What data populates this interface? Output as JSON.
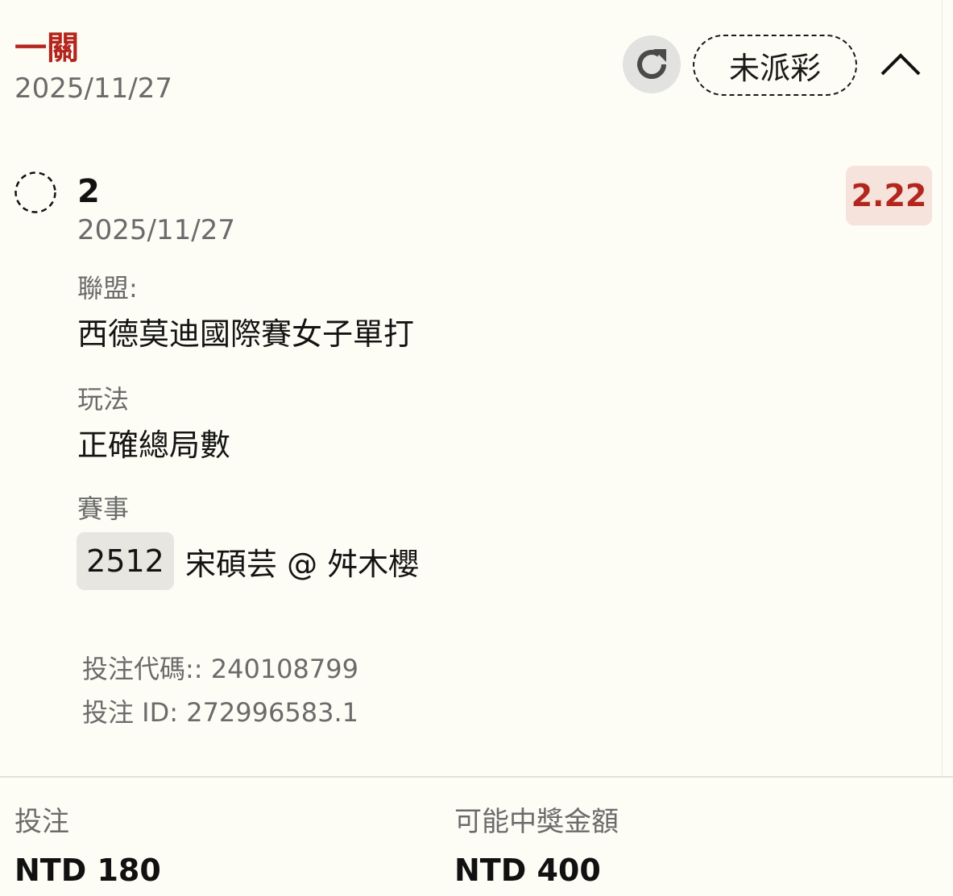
{
  "header": {
    "bet_type": "一關",
    "date": "2025/11/27",
    "status": "未派彩"
  },
  "selection": {
    "pick": "2",
    "date": "2025/11/27",
    "odds": "2.22",
    "league_label": "聯盟:",
    "league": "西德莫迪國際賽女子單打",
    "market_label": "玩法",
    "market": "正確總局數",
    "event_label": "賽事",
    "event_code": "2512",
    "event_name": "宋碩芸 @ 舛木櫻"
  },
  "bet_meta": {
    "code_line": "投注代碼:: 240108799",
    "id_line": "投注 ID: 272996583.1"
  },
  "footer": {
    "stake_label": "投注",
    "stake_value": "NTD 180",
    "payout_label": "可能中獎金額",
    "payout_value": "NTD 400"
  },
  "icons": {
    "refresh": "refresh-icon",
    "collapse": "chevron-up-icon",
    "pending": "pending-circle-icon"
  },
  "colors": {
    "accent": "#b3261e",
    "odds_bg": "#f5e3dc",
    "background": "#fdfcf5"
  }
}
